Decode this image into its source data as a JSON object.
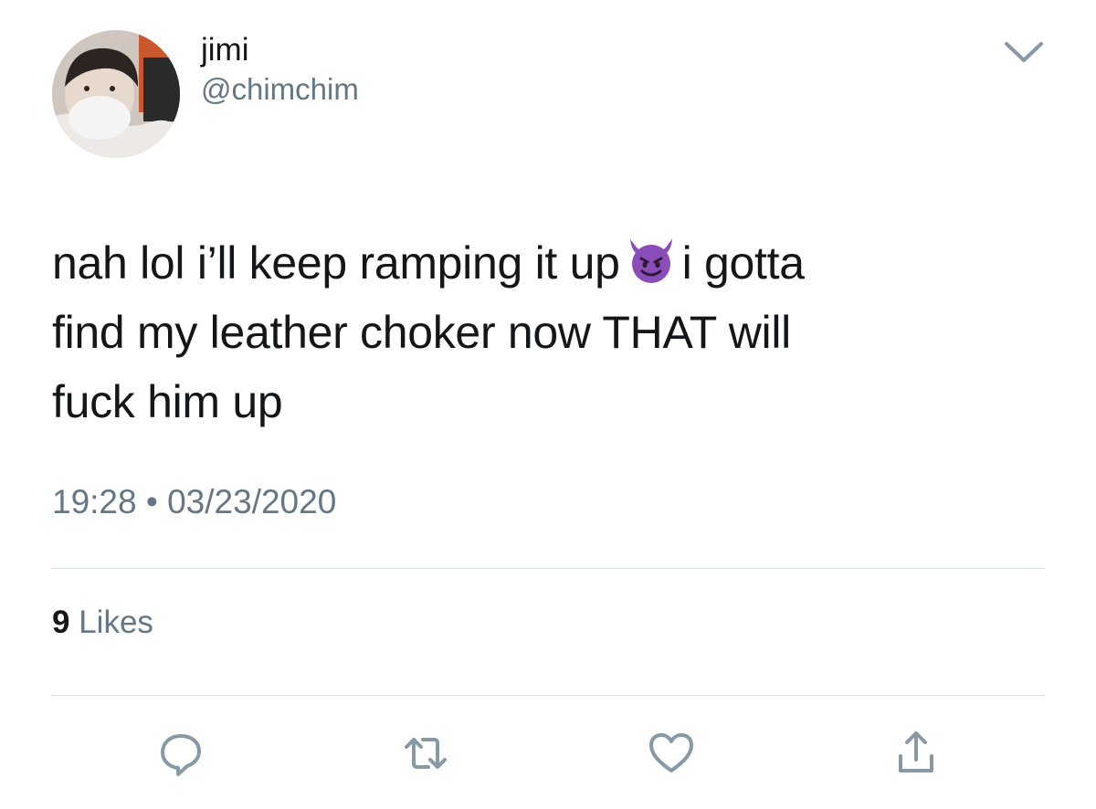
{
  "user": {
    "display_name": "jimi",
    "handle": "@chimchim"
  },
  "tweet": {
    "line1_before": "nah lol i’ll keep ramping it up",
    "line1_emoji": "smiling-devil-emoji",
    "line1_after": "i gotta",
    "line2": "find my leather choker now THAT will",
    "line3": "fuck him up"
  },
  "meta": {
    "timestamp": "19:28 • 03/23/2020"
  },
  "stats": {
    "likes_count": "9",
    "likes_label": "Likes"
  },
  "actions": {
    "reply_icon": "reply-icon",
    "retweet_icon": "retweet-icon",
    "like_icon": "heart-icon",
    "share_icon": "share-icon"
  },
  "colors": {
    "text": "#14171a",
    "secondary": "#657786",
    "icon": "#8899a6",
    "emoji_purple": "#8b4db8"
  }
}
